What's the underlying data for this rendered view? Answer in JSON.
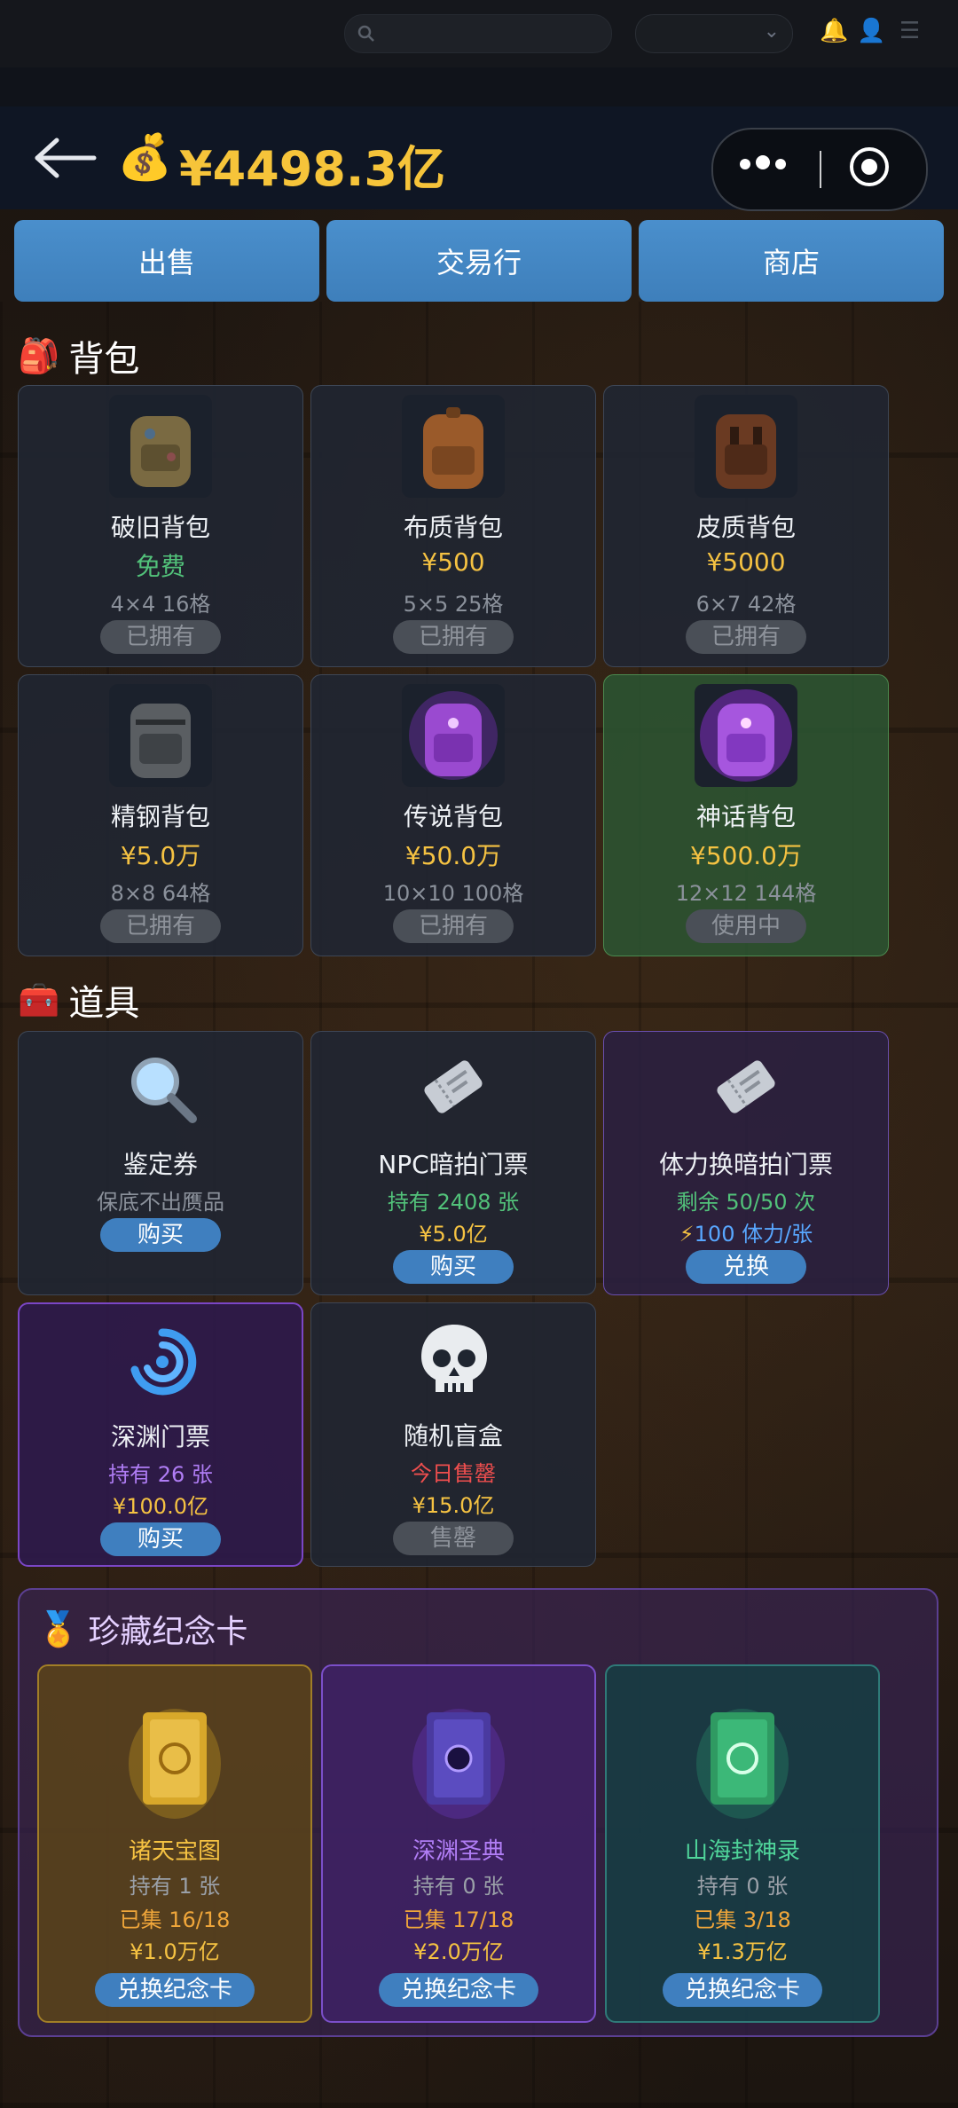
{
  "topbar": {
    "search_placeholder": ""
  },
  "header": {
    "balance": "¥4498.3亿",
    "balance_icon": "money-bag-icon"
  },
  "tabs": [
    {
      "label": "出售"
    },
    {
      "label": "交易行"
    },
    {
      "label": "商店"
    }
  ],
  "bags": {
    "title": "背包",
    "items": [
      {
        "name": "破旧背包",
        "price": "免费",
        "grid": "4×4 16格",
        "status": "已拥有"
      },
      {
        "name": "布质背包",
        "price": "¥500",
        "grid": "5×5 25格",
        "status": "已拥有"
      },
      {
        "name": "皮质背包",
        "price": "¥5000",
        "grid": "6×7 42格",
        "status": "已拥有"
      },
      {
        "name": "精钢背包",
        "price": "¥5.0万",
        "grid": "8×8 64格",
        "status": "已拥有"
      },
      {
        "name": "传说背包",
        "price": "¥50.0万",
        "grid": "10×10 100格",
        "status": "已拥有"
      },
      {
        "name": "神话背包",
        "price": "¥500.0万",
        "grid": "12×12 144格",
        "status": "使用中"
      }
    ]
  },
  "tools": {
    "title": "道具",
    "items": [
      {
        "name": "鉴定券",
        "line1": "保底不出赝品",
        "button": "购买"
      },
      {
        "name": "NPC暗拍门票",
        "line1": "持有 2408 张",
        "line2": "¥5.0亿",
        "button": "购买"
      },
      {
        "name": "体力换暗拍门票",
        "line1": "剩余 50/50 次",
        "line2_bolt": "⚡",
        "line2": "100 体力/张",
        "button": "兑换"
      },
      {
        "name": "深渊门票",
        "line1": "持有 26 张",
        "line2": "¥100.0亿",
        "button": "购买"
      },
      {
        "name": "随机盲盒",
        "line1": "今日售罄",
        "line2": "¥15.0亿",
        "button": "售罄"
      }
    ]
  },
  "collection": {
    "title": "珍藏纪念卡",
    "items": [
      {
        "name": "诸天宝图",
        "hold": "持有 1 张",
        "collected": "已集 16/18",
        "price": "¥1.0万亿",
        "button": "兑换纪念卡",
        "color": "#f5c242"
      },
      {
        "name": "深渊圣典",
        "hold": "持有 0 张",
        "collected": "已集 17/18",
        "price": "¥2.0万亿",
        "button": "兑换纪念卡",
        "color": "#b07df5"
      },
      {
        "name": "山海封神录",
        "hold": "持有 0 张",
        "collected": "已集 3/18",
        "price": "¥1.3万亿",
        "button": "兑换纪念卡",
        "color": "#4fd49a"
      }
    ]
  }
}
